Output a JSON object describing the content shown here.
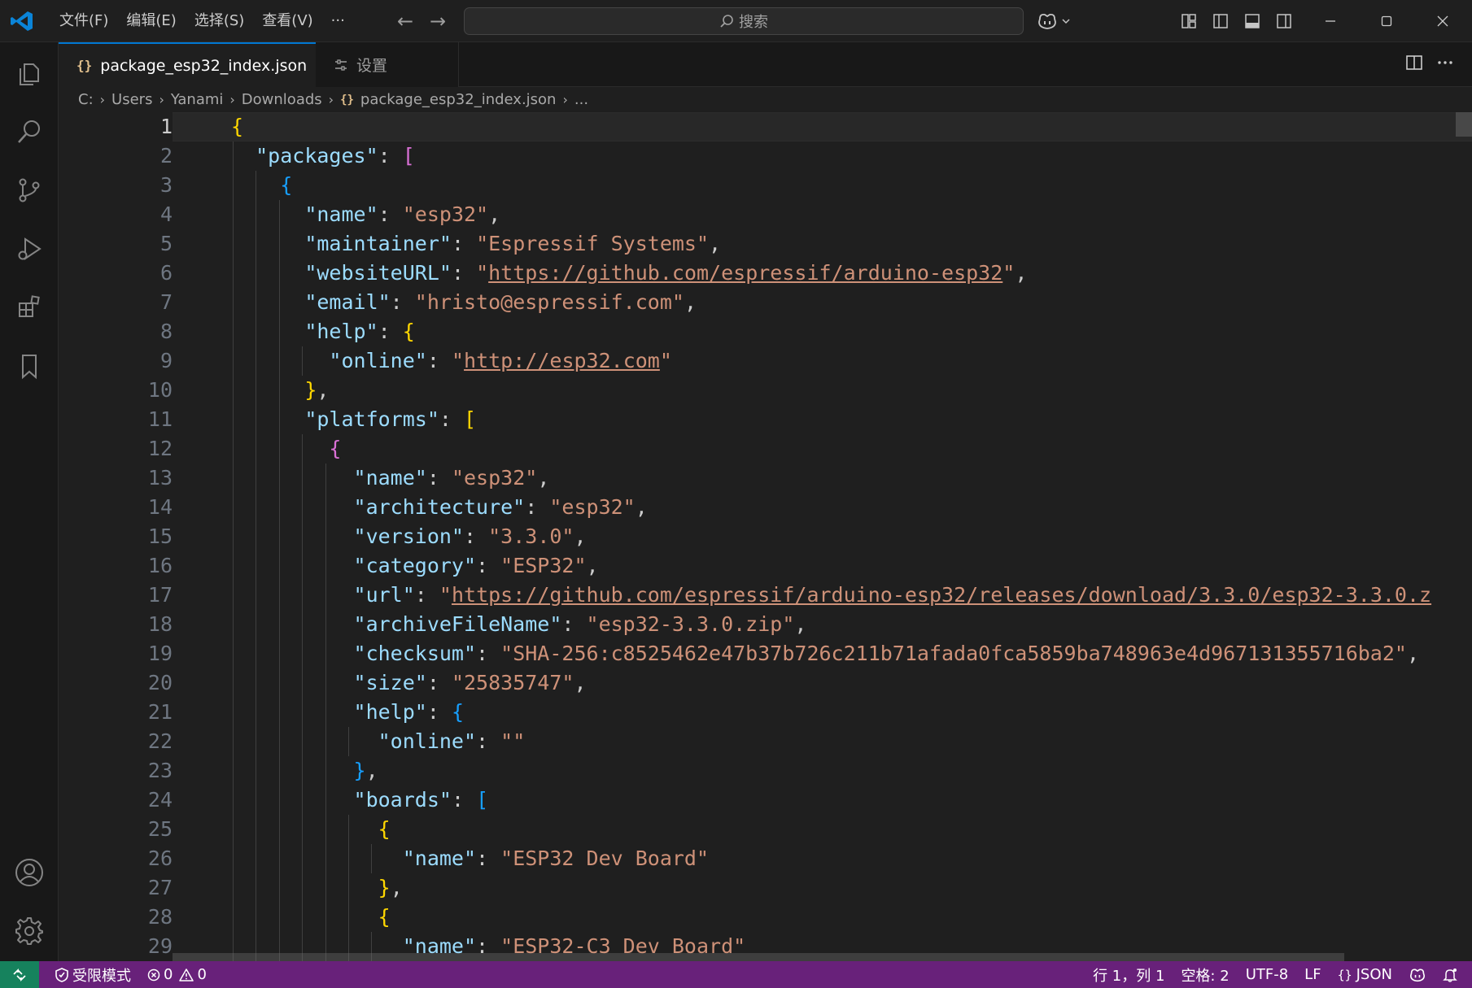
{
  "menu": [
    "文件(F)",
    "编辑(E)",
    "选择(S)",
    "查看(V)",
    "···"
  ],
  "search": {
    "label": "搜索"
  },
  "tabs": [
    {
      "label": "package_esp32_index.json",
      "active": true
    },
    {
      "label": "设置",
      "active": false
    }
  ],
  "breadcrumb": [
    "C:",
    "Users",
    "Yanami",
    "Downloads",
    "package_esp32_index.json",
    "..."
  ],
  "editor": {
    "line_numbers": [
      "1",
      "2",
      "3",
      "4",
      "5",
      "6",
      "7",
      "8",
      "9",
      "10",
      "11",
      "12",
      "13",
      "14",
      "15",
      "16",
      "17",
      "18",
      "19",
      "20",
      "21",
      "22",
      "23",
      "24",
      "25",
      "26",
      "27",
      "28",
      "29"
    ],
    "current_line": 1,
    "lines": [
      "{",
      "  \"packages\": [",
      "    {",
      "      \"name\": \"esp32\",",
      "      \"maintainer\": \"Espressif Systems\",",
      "      \"websiteURL\": \"https://github.com/espressif/arduino-esp32\",",
      "      \"email\": \"hristo@espressif.com\",",
      "      \"help\": {",
      "        \"online\": \"http://esp32.com\"",
      "      },",
      "      \"platforms\": [",
      "        {",
      "          \"name\": \"esp32\",",
      "          \"architecture\": \"esp32\",",
      "          \"version\": \"3.3.0\",",
      "          \"category\": \"ESP32\",",
      "          \"url\": \"https://github.com/espressif/arduino-esp32/releases/download/3.3.0/esp32-3.3.0.z",
      "          \"archiveFileName\": \"esp32-3.3.0.zip\",",
      "          \"checksum\": \"SHA-256:c8525462e47b37b726c211b71afada0fca5859ba748963e4d967131355716ba2\",",
      "          \"size\": \"25835747\",",
      "          \"help\": {",
      "            \"online\": \"\"",
      "          },",
      "          \"boards\": [",
      "            {",
      "              \"name\": \"ESP32 Dev Board\"",
      "            },",
      "            {",
      "              \"name\": \"ESP32-C3 Dev Board\""
    ]
  },
  "status": {
    "restricted": "受限模式",
    "errors": "0",
    "warnings": "0",
    "position": "行 1，列 1",
    "spaces": "空格: 2",
    "encoding": "UTF-8",
    "eol": "LF",
    "language": "JSON"
  },
  "colors": {
    "accent": "#0078d4",
    "statusbar": "#68217a",
    "remote": "#16825d",
    "string": "#ce9178",
    "key": "#9cdcfe"
  }
}
